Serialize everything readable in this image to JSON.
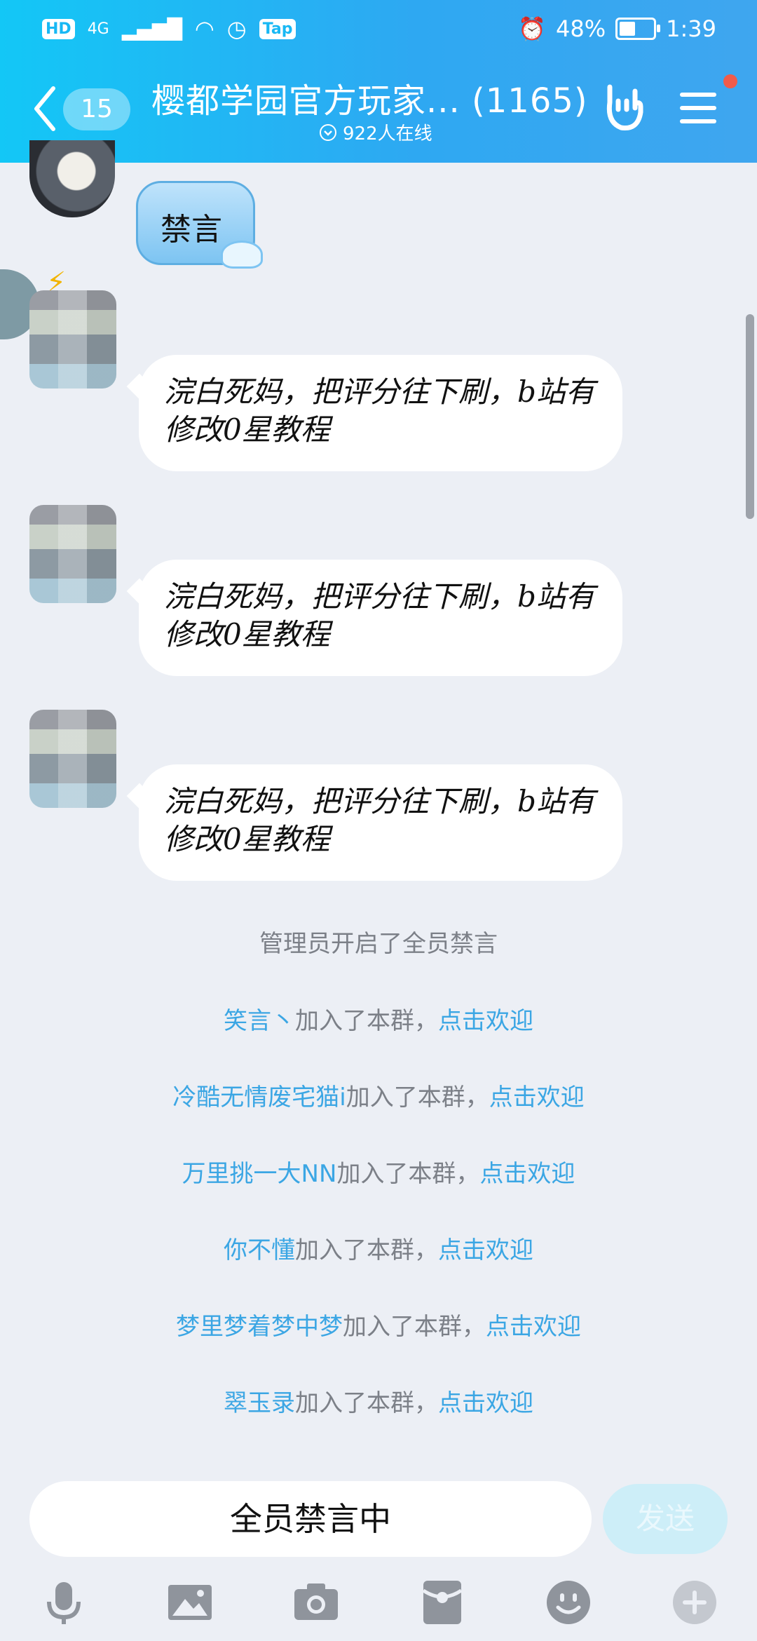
{
  "status_bar": {
    "left": [
      "HD",
      "4G",
      "Tap"
    ],
    "battery": "48%",
    "time": "1:39"
  },
  "header": {
    "back_count": "15",
    "title": "樱都学园官方玩家... (1165)",
    "online": "922人在线"
  },
  "messages": [
    {
      "text": "禁言"
    },
    {
      "text": "浣白死妈，把评分往下刷，b站有修改0星教程"
    },
    {
      "text": "浣白死妈，把评分往下刷，b站有修改0星教程"
    },
    {
      "text": "浣白死妈，把评分往下刷，b站有修改0星教程"
    }
  ],
  "system": {
    "mute_notice": "管理员开启了全员禁言",
    "joins": [
      {
        "name": "笑言丶",
        "text": "加入了本群，",
        "action": "点击欢迎"
      },
      {
        "name": "冷酷无情废宅猫i",
        "text": "加入了本群，",
        "action": "点击欢迎"
      },
      {
        "name": "万里挑一大NN",
        "text": "加入了本群，",
        "action": "点击欢迎"
      },
      {
        "name": "你不懂",
        "text": "加入了本群，",
        "action": "点击欢迎"
      },
      {
        "name": "梦里梦着梦中梦",
        "text": "加入了本群，",
        "action": "点击欢迎"
      },
      {
        "name": "翠玉录",
        "text": "加入了本群，",
        "action": "点击欢迎"
      }
    ]
  },
  "input": {
    "placeholder": "全员禁言中",
    "send_label": "发送"
  },
  "toolbar": [
    "microphone-icon",
    "image-icon",
    "camera-icon",
    "red-packet-icon",
    "emoji-icon",
    "plus-icon"
  ],
  "colors": {
    "header_start": "#13c7f6",
    "header_end": "#3fa6ef",
    "link": "#3ba6e4",
    "badge": "#f15b4a"
  }
}
